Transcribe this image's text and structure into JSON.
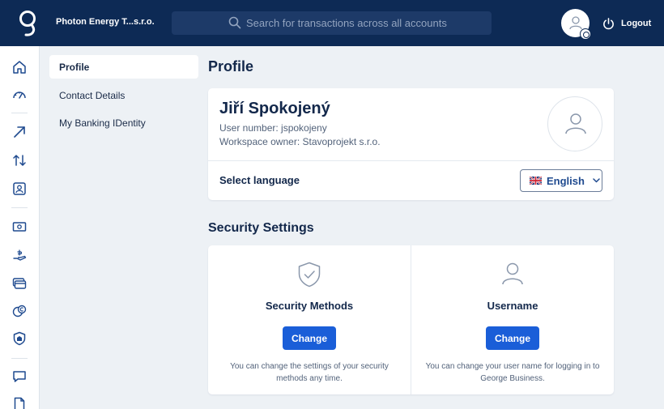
{
  "header": {
    "company": "Photon Energy T...s.r.o.",
    "search_placeholder": "Search for transactions across all accounts",
    "logout_label": "Logout"
  },
  "rail": {
    "icons": [
      "home-icon",
      "dashboard-gauge-icon",
      "payment-arrow-icon",
      "transfers-icon",
      "contacts-icon",
      "cash-icon",
      "loan-hand-icon",
      "cards-icon",
      "currency-icon",
      "insurance-shield-icon",
      "messages-icon",
      "documents-icon"
    ]
  },
  "subnav": {
    "items": [
      "Profile",
      "Contact Details",
      "My Banking IDentity"
    ]
  },
  "profile": {
    "page_title": "Profile",
    "name": "Jiří Spokojený",
    "user_number": "User number: jspokojeny",
    "workspace_owner": "Workspace owner: Stavoprojekt s.r.o.",
    "language_label": "Select language",
    "language_value": "English"
  },
  "security": {
    "title": "Security Settings",
    "methods": {
      "heading": "Security Methods",
      "button": "Change",
      "description": "You can change the settings of your security methods any time."
    },
    "username": {
      "heading": "Username",
      "button": "Change",
      "description": "You can change your user name for logging in to George Business."
    }
  },
  "colors": {
    "header_bg": "#0d2a55",
    "accent_button": "#1a5ed8",
    "page_bg": "#edf1f5"
  }
}
